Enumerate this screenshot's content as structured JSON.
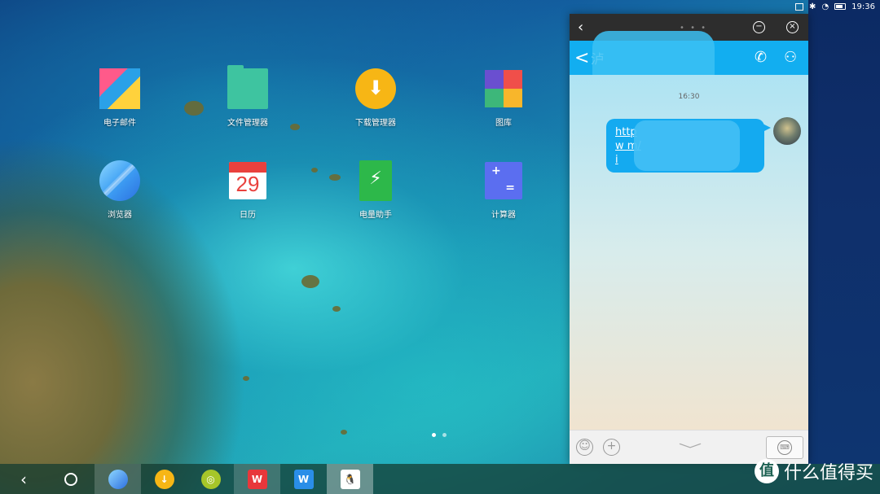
{
  "status_bar": {
    "time": "19:36",
    "icons": [
      "screen-icon",
      "bluetooth-icon",
      "wifi-icon",
      "battery-icon"
    ]
  },
  "desktop": {
    "apps": [
      {
        "label": "电子邮件",
        "icon": "email-icon"
      },
      {
        "label": "文件管理器",
        "icon": "folder-icon"
      },
      {
        "label": "下载管理器",
        "icon": "download-icon"
      },
      {
        "label": "图库",
        "icon": "gallery-icon"
      },
      {
        "label": "浏览器",
        "icon": "browser-icon"
      },
      {
        "label": "日历",
        "icon": "calendar-icon",
        "day": "29"
      },
      {
        "label": "电量助手",
        "icon": "battery-assistant-icon"
      },
      {
        "label": "计算器",
        "icon": "calculator-icon"
      }
    ],
    "page_dots": {
      "count": 2,
      "active": 1
    }
  },
  "chat_window": {
    "titlebar": {
      "handle": "• • •"
    },
    "header": {
      "back_glyph": "<",
      "contact_fragment": "泸"
    },
    "time": "16:30",
    "message": "http\nw                   m/\ni"
  },
  "taskbar": {
    "apps": [
      {
        "name": "browser",
        "color": "#3ea0f4"
      },
      {
        "name": "download",
        "color": "#f7b615"
      },
      {
        "name": "search",
        "color": "#a6c629"
      },
      {
        "name": "wps-office",
        "color": "#e8373b"
      },
      {
        "name": "wps-writer",
        "color": "#2a8ee8"
      },
      {
        "name": "qq",
        "color": "#ffffff"
      }
    ]
  },
  "watermark": {
    "logo": "值",
    "text": "什么值得买"
  },
  "colors": {
    "chat_header": "#12aef0",
    "bubble": "#14aaf0",
    "titlebar": "#2d2d2d"
  }
}
